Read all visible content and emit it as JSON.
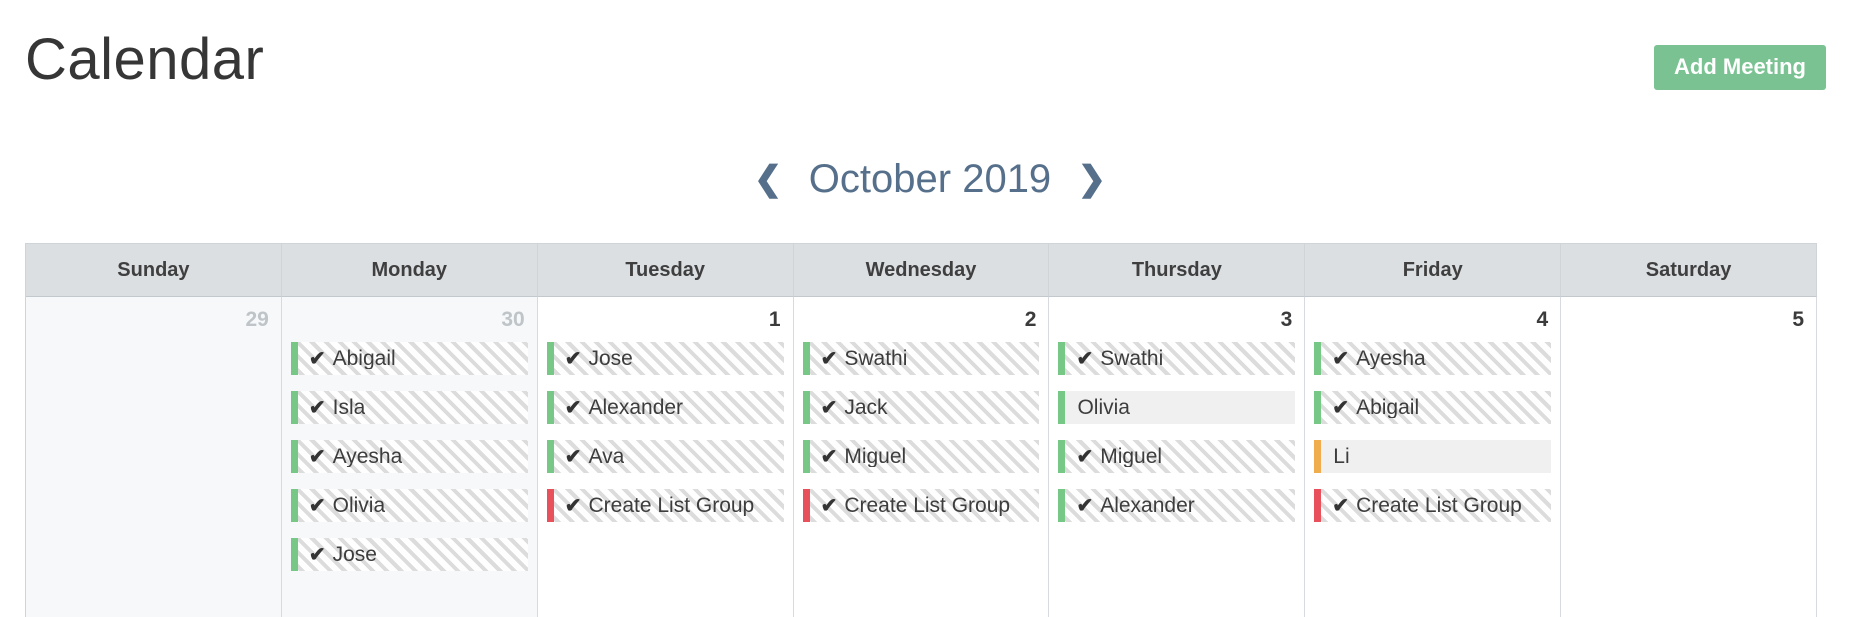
{
  "header": {
    "title": "Calendar",
    "add_meeting_label": "Add Meeting"
  },
  "month_nav": {
    "prev_icon": "❮",
    "next_icon": "❯",
    "label": "October 2019"
  },
  "colors": {
    "accent_green": "#7ac292",
    "event_green": "#77c787",
    "event_orange": "#f0ad4e",
    "event_red": "#e8505b",
    "month_label": "#56708b",
    "weekday_header_bg": "#dbdfe2"
  },
  "weekdays": [
    "Sunday",
    "Monday",
    "Tuesday",
    "Wednesday",
    "Thursday",
    "Friday",
    "Saturday"
  ],
  "week": [
    {
      "day_number": "29",
      "other_month": true,
      "events": []
    },
    {
      "day_number": "30",
      "other_month": true,
      "events": [
        {
          "title": "Abigail",
          "check": "✔",
          "color": "#77c787",
          "striped": true
        },
        {
          "title": "Isla",
          "check": "✔",
          "color": "#77c787",
          "striped": true
        },
        {
          "title": "Ayesha",
          "check": "✔",
          "color": "#77c787",
          "striped": true
        },
        {
          "title": "Olivia",
          "check": "✔",
          "color": "#77c787",
          "striped": true
        },
        {
          "title": "Jose",
          "check": "✔",
          "color": "#77c787",
          "striped": true
        }
      ]
    },
    {
      "day_number": "1",
      "other_month": false,
      "events": [
        {
          "title": "Jose",
          "check": "✔",
          "color": "#77c787",
          "striped": true
        },
        {
          "title": "Alexander",
          "check": "✔",
          "color": "#77c787",
          "striped": true
        },
        {
          "title": "Ava",
          "check": "✔",
          "color": "#77c787",
          "striped": true
        },
        {
          "title": "Create List Group",
          "check": "✔",
          "color": "#e8505b",
          "striped": true
        }
      ]
    },
    {
      "day_number": "2",
      "other_month": false,
      "events": [
        {
          "title": "Swathi",
          "check": "✔",
          "color": "#77c787",
          "striped": true
        },
        {
          "title": "Jack",
          "check": "✔",
          "color": "#77c787",
          "striped": true
        },
        {
          "title": "Miguel",
          "check": "✔",
          "color": "#77c787",
          "striped": true
        },
        {
          "title": "Create List Group",
          "check": "✔",
          "color": "#e8505b",
          "striped": true
        }
      ]
    },
    {
      "day_number": "3",
      "other_month": false,
      "events": [
        {
          "title": "Swathi",
          "check": "✔",
          "color": "#77c787",
          "striped": true
        },
        {
          "title": "Olivia",
          "check": "",
          "color": "#77c787",
          "striped": false
        },
        {
          "title": "Miguel",
          "check": "✔",
          "color": "#77c787",
          "striped": true
        },
        {
          "title": "Alexander",
          "check": "✔",
          "color": "#77c787",
          "striped": true
        }
      ]
    },
    {
      "day_number": "4",
      "other_month": false,
      "events": [
        {
          "title": "Ayesha",
          "check": "✔",
          "color": "#77c787",
          "striped": true
        },
        {
          "title": "Abigail",
          "check": "✔",
          "color": "#77c787",
          "striped": true
        },
        {
          "title": "Li",
          "check": "",
          "color": "#f0ad4e",
          "striped": false
        },
        {
          "title": "Create List Group",
          "check": "✔",
          "color": "#e8505b",
          "striped": true
        }
      ]
    },
    {
      "day_number": "5",
      "other_month": false,
      "events": []
    }
  ]
}
